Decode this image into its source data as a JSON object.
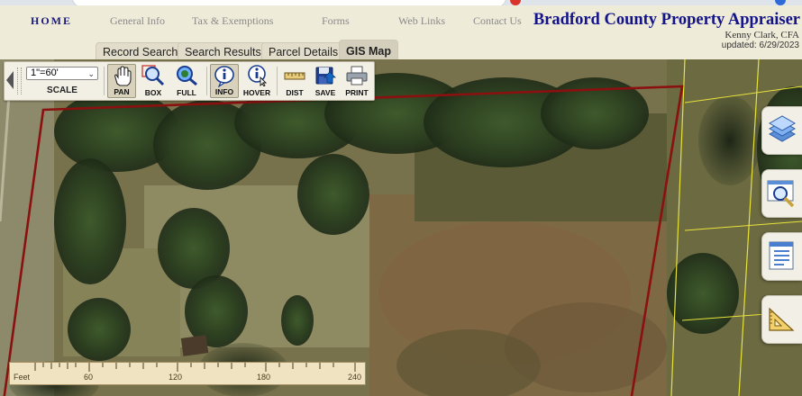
{
  "nav": {
    "items": [
      {
        "label": "HOME"
      },
      {
        "label": "General Info"
      },
      {
        "label": "Tax & Exemptions"
      },
      {
        "label": "Forms"
      },
      {
        "label": "Web Links"
      },
      {
        "label": "Contact Us"
      }
    ]
  },
  "site": {
    "title": "Bradford County Property Appraiser",
    "appraiser": "Kenny Clark, CFA",
    "updated": "updated: 6/29/2023"
  },
  "tabs": [
    {
      "label": "Record Search",
      "active": false
    },
    {
      "label": "Search Results",
      "active": false
    },
    {
      "label": "Parcel Details",
      "active": false
    },
    {
      "label": "GIS Map",
      "active": true
    }
  ],
  "toolbar": {
    "scale_value": "1\"=60'",
    "scale_label": "SCALE",
    "buttons": [
      {
        "label": "PAN",
        "icon": "hand-icon",
        "pressed": true
      },
      {
        "label": "BOX",
        "icon": "zoom-box-icon",
        "pressed": false
      },
      {
        "label": "FULL",
        "icon": "zoom-full-icon",
        "pressed": false
      },
      {
        "label": "INFO",
        "icon": "info-icon",
        "pressed": true
      },
      {
        "label": "HOVER",
        "icon": "hover-info-icon",
        "pressed": false
      },
      {
        "label": "DIST",
        "icon": "ruler-icon",
        "pressed": false
      },
      {
        "label": "SAVE",
        "icon": "save-icon",
        "pressed": false
      },
      {
        "label": "PRINT",
        "icon": "printer-icon",
        "pressed": false
      }
    ]
  },
  "side_buttons": [
    {
      "icon": "layers-icon"
    },
    {
      "icon": "search-map-icon"
    },
    {
      "icon": "document-icon"
    },
    {
      "icon": "measure-icon"
    }
  ],
  "ruler": {
    "unit": "Feet",
    "ticks": [
      "60",
      "120",
      "180",
      "240"
    ]
  },
  "colors": {
    "title": "#14148a",
    "parcel_outline": "#8b1010",
    "parcel_lines": "#e8e23a"
  }
}
